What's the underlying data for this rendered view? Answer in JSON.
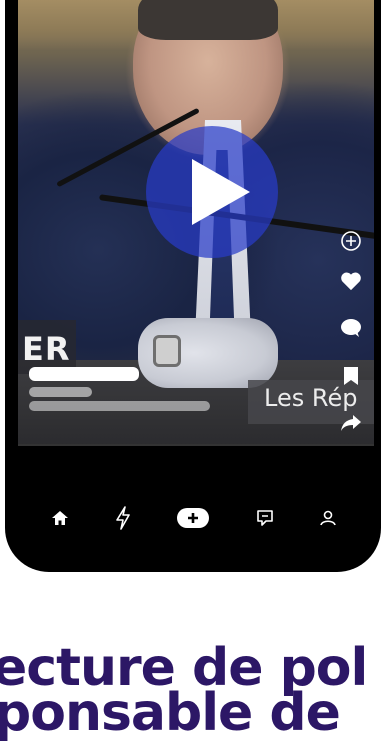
{
  "video": {
    "caption_overlay": "ER",
    "lower_third": "Les Rép",
    "progress": 0.0
  },
  "side_actions": [
    {
      "name": "add-icon",
      "glyph": "⊕"
    },
    {
      "name": "heart-icon",
      "glyph": "♥"
    },
    {
      "name": "comment-icon",
      "glyph": "●"
    },
    {
      "name": "bookmark-icon",
      "glyph": "▮"
    },
    {
      "name": "share-icon",
      "glyph": "➦"
    }
  ],
  "bottom_nav": [
    {
      "name": "home-icon"
    },
    {
      "name": "lightning-icon"
    },
    {
      "name": "create-icon"
    },
    {
      "name": "inbox-icon"
    },
    {
      "name": "profile-icon"
    }
  ],
  "headline": {
    "line1": "ecture de pol",
    "line2": "ponsable de"
  },
  "colors": {
    "headline": "#2c1766",
    "play_button": "#2838c8",
    "background": "#ffffff"
  }
}
